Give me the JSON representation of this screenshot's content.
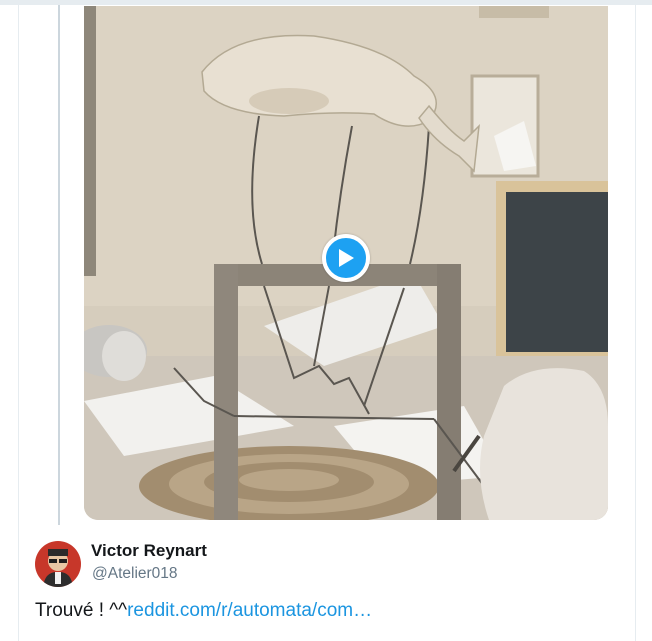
{
  "tweet": {
    "author_name": "Victor Reynart",
    "author_handle": "@Atelier018",
    "text_prefix": "Trouvé ! ^^",
    "link_text": "reddit.com/r/automata/com…"
  },
  "icons": {
    "play": "play-icon",
    "avatar": "avatar-image"
  },
  "colors": {
    "accent": "#1da1f2",
    "link": "#1b95e0",
    "name": "#14171a",
    "handle": "#657786",
    "border": "#e6ecf0"
  }
}
